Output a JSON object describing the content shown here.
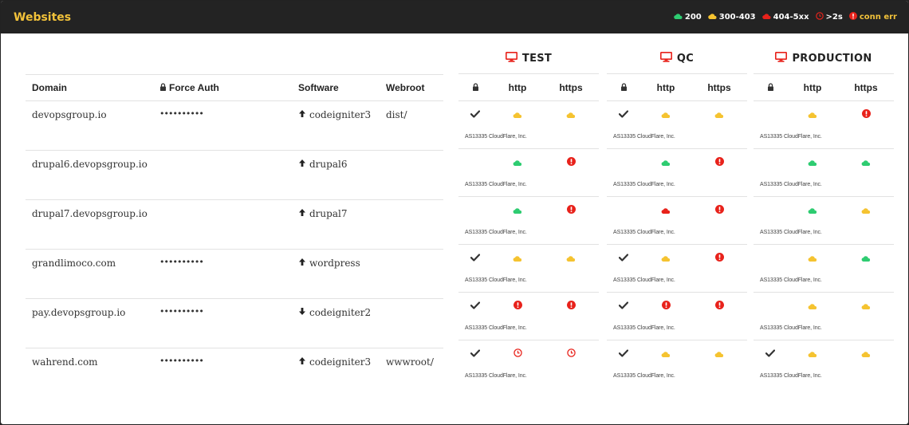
{
  "app": {
    "title": "Websites"
  },
  "legend": [
    {
      "icon": "cloud-icon",
      "color": "#2ecc71",
      "label": "200"
    },
    {
      "icon": "cloud-icon",
      "color": "#f5c330",
      "label": "300-403"
    },
    {
      "icon": "cloud-icon",
      "color": "#e8221b",
      "label": "404-5xx"
    },
    {
      "icon": "clock-icon",
      "color": "#e8221b",
      "label": ">2s"
    },
    {
      "icon": "error-icon",
      "color": "#e8221b",
      "label": "conn err"
    }
  ],
  "colors": {
    "ok": "#2ecc71",
    "warn": "#f5c330",
    "error": "#e8221b",
    "brand": "#f2c23a",
    "bar": "#232323"
  },
  "table": {
    "headers": {
      "domain": "Domain",
      "force_auth": "Force Auth",
      "software": "Software",
      "webroot": "Webroot"
    },
    "rows": [
      {
        "domain": "devopsgroup.io",
        "auth": "••••••••••",
        "software": "codeigniter3",
        "direction": "up",
        "webroot": "dist/"
      },
      {
        "domain": "drupal6.devopsgroup.io",
        "auth": "",
        "software": "drupal6",
        "direction": "up",
        "webroot": ""
      },
      {
        "domain": "drupal7.devopsgroup.io",
        "auth": "",
        "software": "drupal7",
        "direction": "up",
        "webroot": ""
      },
      {
        "domain": "grandlimoco.com",
        "auth": "••••••••••",
        "software": "wordpress",
        "direction": "up",
        "webroot": ""
      },
      {
        "domain": "pay.devopsgroup.io",
        "auth": "••••••••••",
        "software": "codeigniter2",
        "direction": "down",
        "webroot": ""
      },
      {
        "domain": "wahrend.com",
        "auth": "••••••••••",
        "software": "codeigniter3",
        "direction": "up",
        "webroot": "wwwroot/"
      }
    ]
  },
  "env_headers": {
    "http": "http",
    "https": "https"
  },
  "asn_label": "AS13335 CloudFlare, Inc.",
  "environments": [
    {
      "name": "TEST",
      "rows": [
        {
          "lock": true,
          "http": "warn",
          "https": "warn"
        },
        {
          "lock": false,
          "http": "ok",
          "https": "err"
        },
        {
          "lock": false,
          "http": "ok",
          "https": "err"
        },
        {
          "lock": true,
          "http": "warn",
          "https": "warn"
        },
        {
          "lock": true,
          "http": "err",
          "https": "err"
        },
        {
          "lock": true,
          "http": "slow",
          "https": "slow"
        }
      ]
    },
    {
      "name": "QC",
      "rows": [
        {
          "lock": true,
          "http": "warn",
          "https": "warn"
        },
        {
          "lock": false,
          "http": "ok",
          "https": "err"
        },
        {
          "lock": false,
          "http": "fail",
          "https": "err"
        },
        {
          "lock": true,
          "http": "warn",
          "https": "err"
        },
        {
          "lock": true,
          "http": "err",
          "https": "err"
        },
        {
          "lock": true,
          "http": "warn",
          "https": "warn"
        }
      ]
    },
    {
      "name": "PRODUCTION",
      "rows": [
        {
          "lock": false,
          "http": "warn",
          "https": "err"
        },
        {
          "lock": false,
          "http": "ok",
          "https": "ok"
        },
        {
          "lock": false,
          "http": "ok",
          "https": "warn"
        },
        {
          "lock": false,
          "http": "warn",
          "https": "ok"
        },
        {
          "lock": false,
          "http": "warn",
          "https": "warn"
        },
        {
          "lock": true,
          "http": "warn",
          "https": "warn"
        }
      ]
    }
  ]
}
